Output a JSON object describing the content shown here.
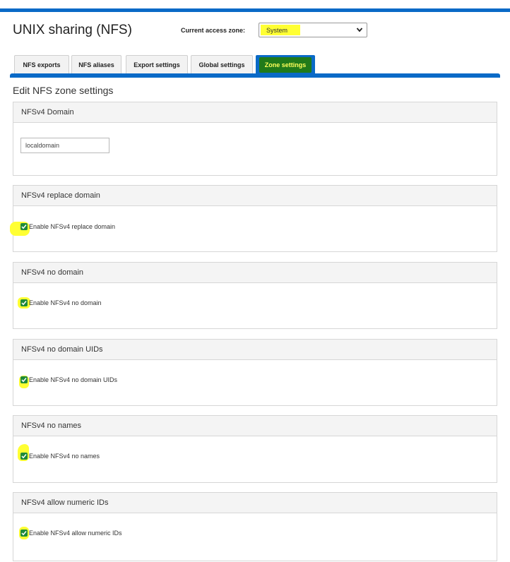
{
  "header": {
    "title": "UNIX sharing (NFS)",
    "zone_label": "Current access zone:",
    "zone_value": "System",
    "chevron_icon": "chevron-down-icon"
  },
  "tabs": [
    {
      "label": "NFS exports",
      "active": false
    },
    {
      "label": "NFS aliases",
      "active": false
    },
    {
      "label": "Export settings",
      "active": false
    },
    {
      "label": "Global settings",
      "active": false
    },
    {
      "label": "Zone settings",
      "active": true
    }
  ],
  "main": {
    "heading": "Edit NFS zone settings",
    "domain_panel": {
      "title": "NFSv4 Domain",
      "input_value": "localdomain"
    },
    "panels": [
      {
        "title": "NFSv4 replace domain",
        "checkbox_label": "Enable NFSv4 replace domain",
        "checked": true
      },
      {
        "title": "NFSv4 no domain",
        "checkbox_label": "Enable NFSv4 no domain",
        "checked": true
      },
      {
        "title": "NFSv4 no domain UIDs",
        "checkbox_label": "Enable NFSv4 no domain UIDs",
        "checked": true
      },
      {
        "title": "NFSv4 no names",
        "checkbox_label": "Enable NFSv4 no names",
        "checked": true
      },
      {
        "title": "NFSv4 allow numeric IDs",
        "checkbox_label": "Enable NFSv4 allow numeric IDs",
        "checked": true
      }
    ]
  },
  "colors": {
    "accent_blue": "#0a6ac7",
    "highlight_yellow": "#ffff33",
    "active_tab_highlight": "#207a1a",
    "checkbox_green": "#1f8a3a"
  }
}
